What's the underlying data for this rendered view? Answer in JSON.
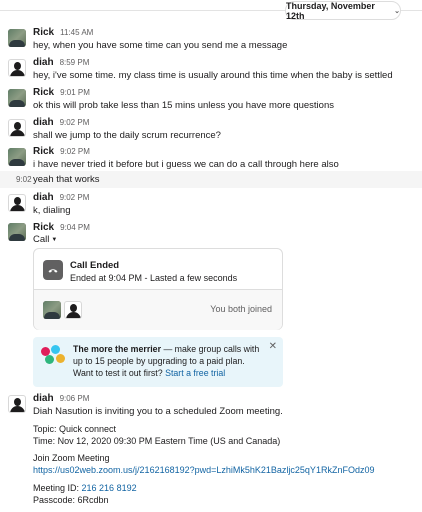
{
  "date_divider": {
    "label": "Thursday, November 12th"
  },
  "messages": [
    {
      "author": "Rick",
      "time": "11:45 AM",
      "text": "hey, when you have some time can you send me a message"
    },
    {
      "author": "diah",
      "time": "8:59 PM",
      "text": "hey, i've some time. my class time is usually around this time when the baby is settled"
    },
    {
      "author": "Rick",
      "time": "9:01 PM",
      "text": "ok this will prob take less than 15 mins unless you have more questions"
    },
    {
      "author": "diah",
      "time": "9:02 PM",
      "text": "shall we jump to the daily scrum recurrence?"
    },
    {
      "author": "Rick",
      "time": "9:02 PM",
      "text": "i have never tried it before but i guess we can do a call through here also"
    },
    {
      "author": "diah",
      "time": "9:02 PM",
      "text": "k, dialing"
    },
    {
      "author": "Rick",
      "time": "9:04 PM",
      "text": "Call"
    }
  ],
  "continuation": {
    "time": "9:02",
    "text": "yeah that works"
  },
  "call_card": {
    "title": "Call Ended",
    "subtitle": "Ended at 9:04 PM - Lasted a few seconds",
    "joined_text": "You both joined"
  },
  "promo": {
    "bold": "The more the merrier",
    "text": " — make group calls with up to 15 people by upgrading to a paid plan. Want to test it out first? ",
    "link": "Start a free trial",
    "close": "✕"
  },
  "zoom_message": {
    "author": "diah",
    "time": "9:06 PM",
    "invite": "Diah Nasution is inviting you to a scheduled Zoom meeting.",
    "topic": "Topic: Quick connect",
    "when": "Time: Nov 12, 2020 09:30 PM Eastern Time (US and Canada)",
    "join_label": "Join Zoom Meeting",
    "join_url": "https://us02web.zoom.us/j/2162168192?pwd=LzhiMk5hK21Bazljc25qY1RkZnFOdz09",
    "meeting_id_label": "Meeting ID: ",
    "meeting_id": "216 216 8192",
    "passcode": "Passcode: 6Rcdbn"
  },
  "colors": {
    "link": "#1264a3",
    "promo_bg": "#e8f5fa",
    "muted": "#616061"
  }
}
